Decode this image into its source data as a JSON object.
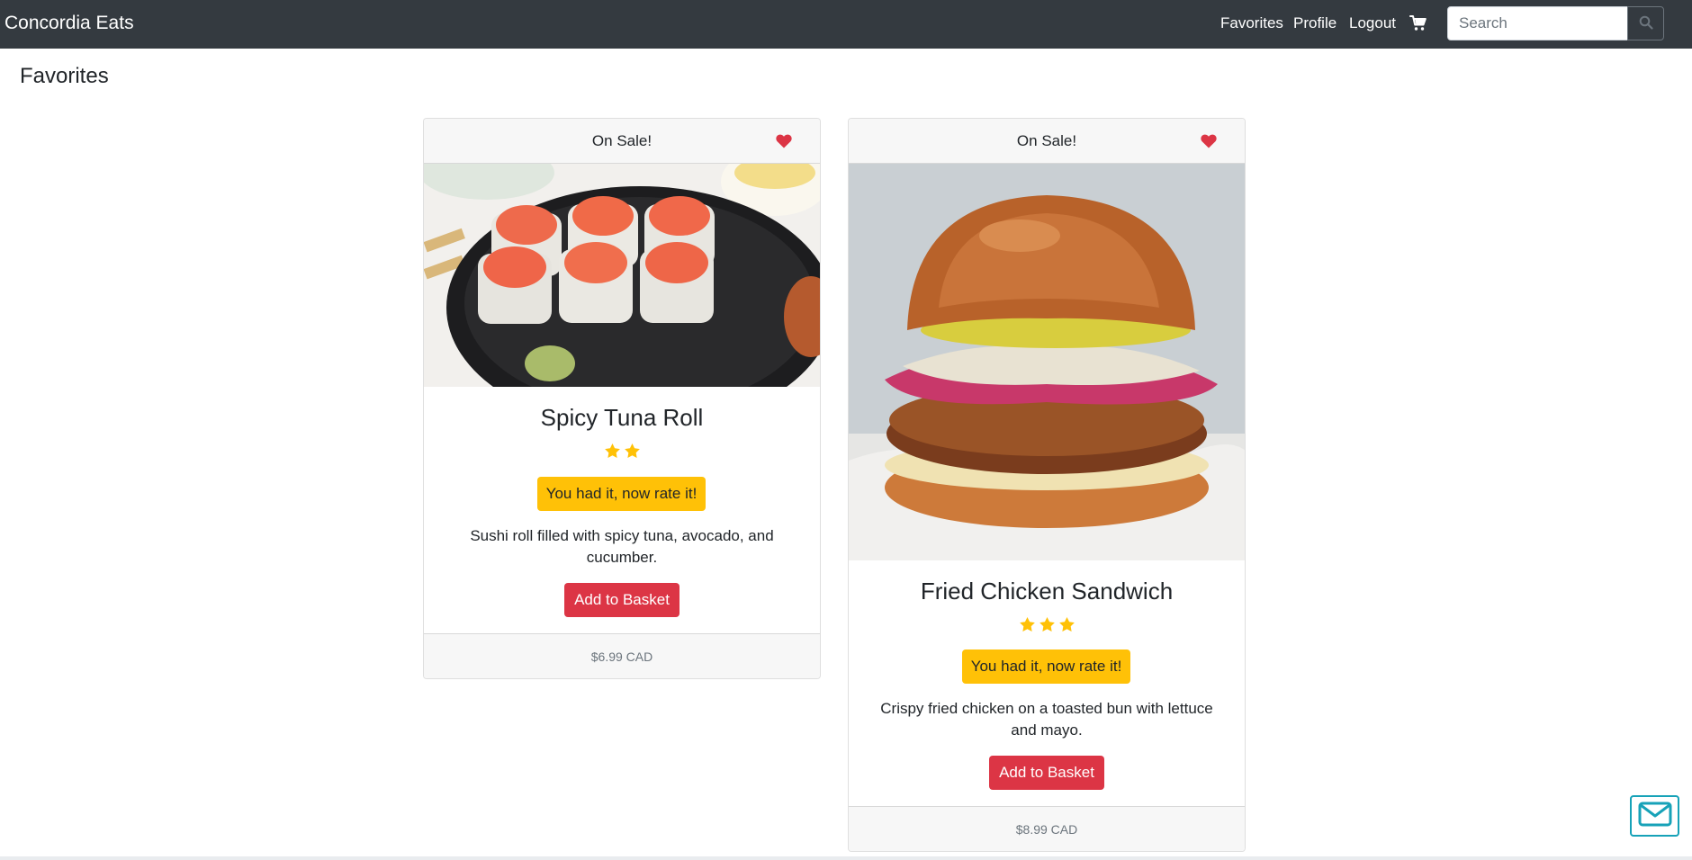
{
  "navbar": {
    "brand": "Concordia Eats",
    "links": {
      "favorites": "Favorites",
      "profile": "Profile",
      "logout": "Logout"
    },
    "cart_icon": "cart-icon",
    "search": {
      "placeholder": "Search",
      "value": "",
      "icon": "search-icon"
    }
  },
  "page": {
    "title": "Favorites"
  },
  "cards": [
    {
      "header": "On Sale!",
      "favorite_icon": "heart-icon",
      "image_alt": "Spicy Tuna Roll photo",
      "title": "Spicy Tuna Roll",
      "rating": 2,
      "rate_label": "You had it, now rate it!",
      "description": "Sushi roll filled with spicy tuna, avocado, and cucumber.",
      "add_label": "Add to Basket",
      "price": "$6.99 CAD"
    },
    {
      "header": "On Sale!",
      "favorite_icon": "heart-icon",
      "image_alt": "Fried Chicken Sandwich photo",
      "title": "Fried Chicken Sandwich",
      "rating": 3,
      "rate_label": "You had it, now rate it!",
      "description": "Crispy fried chicken on a toasted bun with lettuce and mayo.",
      "add_label": "Add to Basket",
      "price": "$8.99 CAD"
    }
  ],
  "widget": {
    "icon": "envelope-icon"
  },
  "colors": {
    "navbar_bg": "#343a40",
    "heart": "#dc3545",
    "star": "#ffc107",
    "rate_button": "#ffc107",
    "add_button": "#dc3545",
    "widget_border": "#17a2b8"
  }
}
